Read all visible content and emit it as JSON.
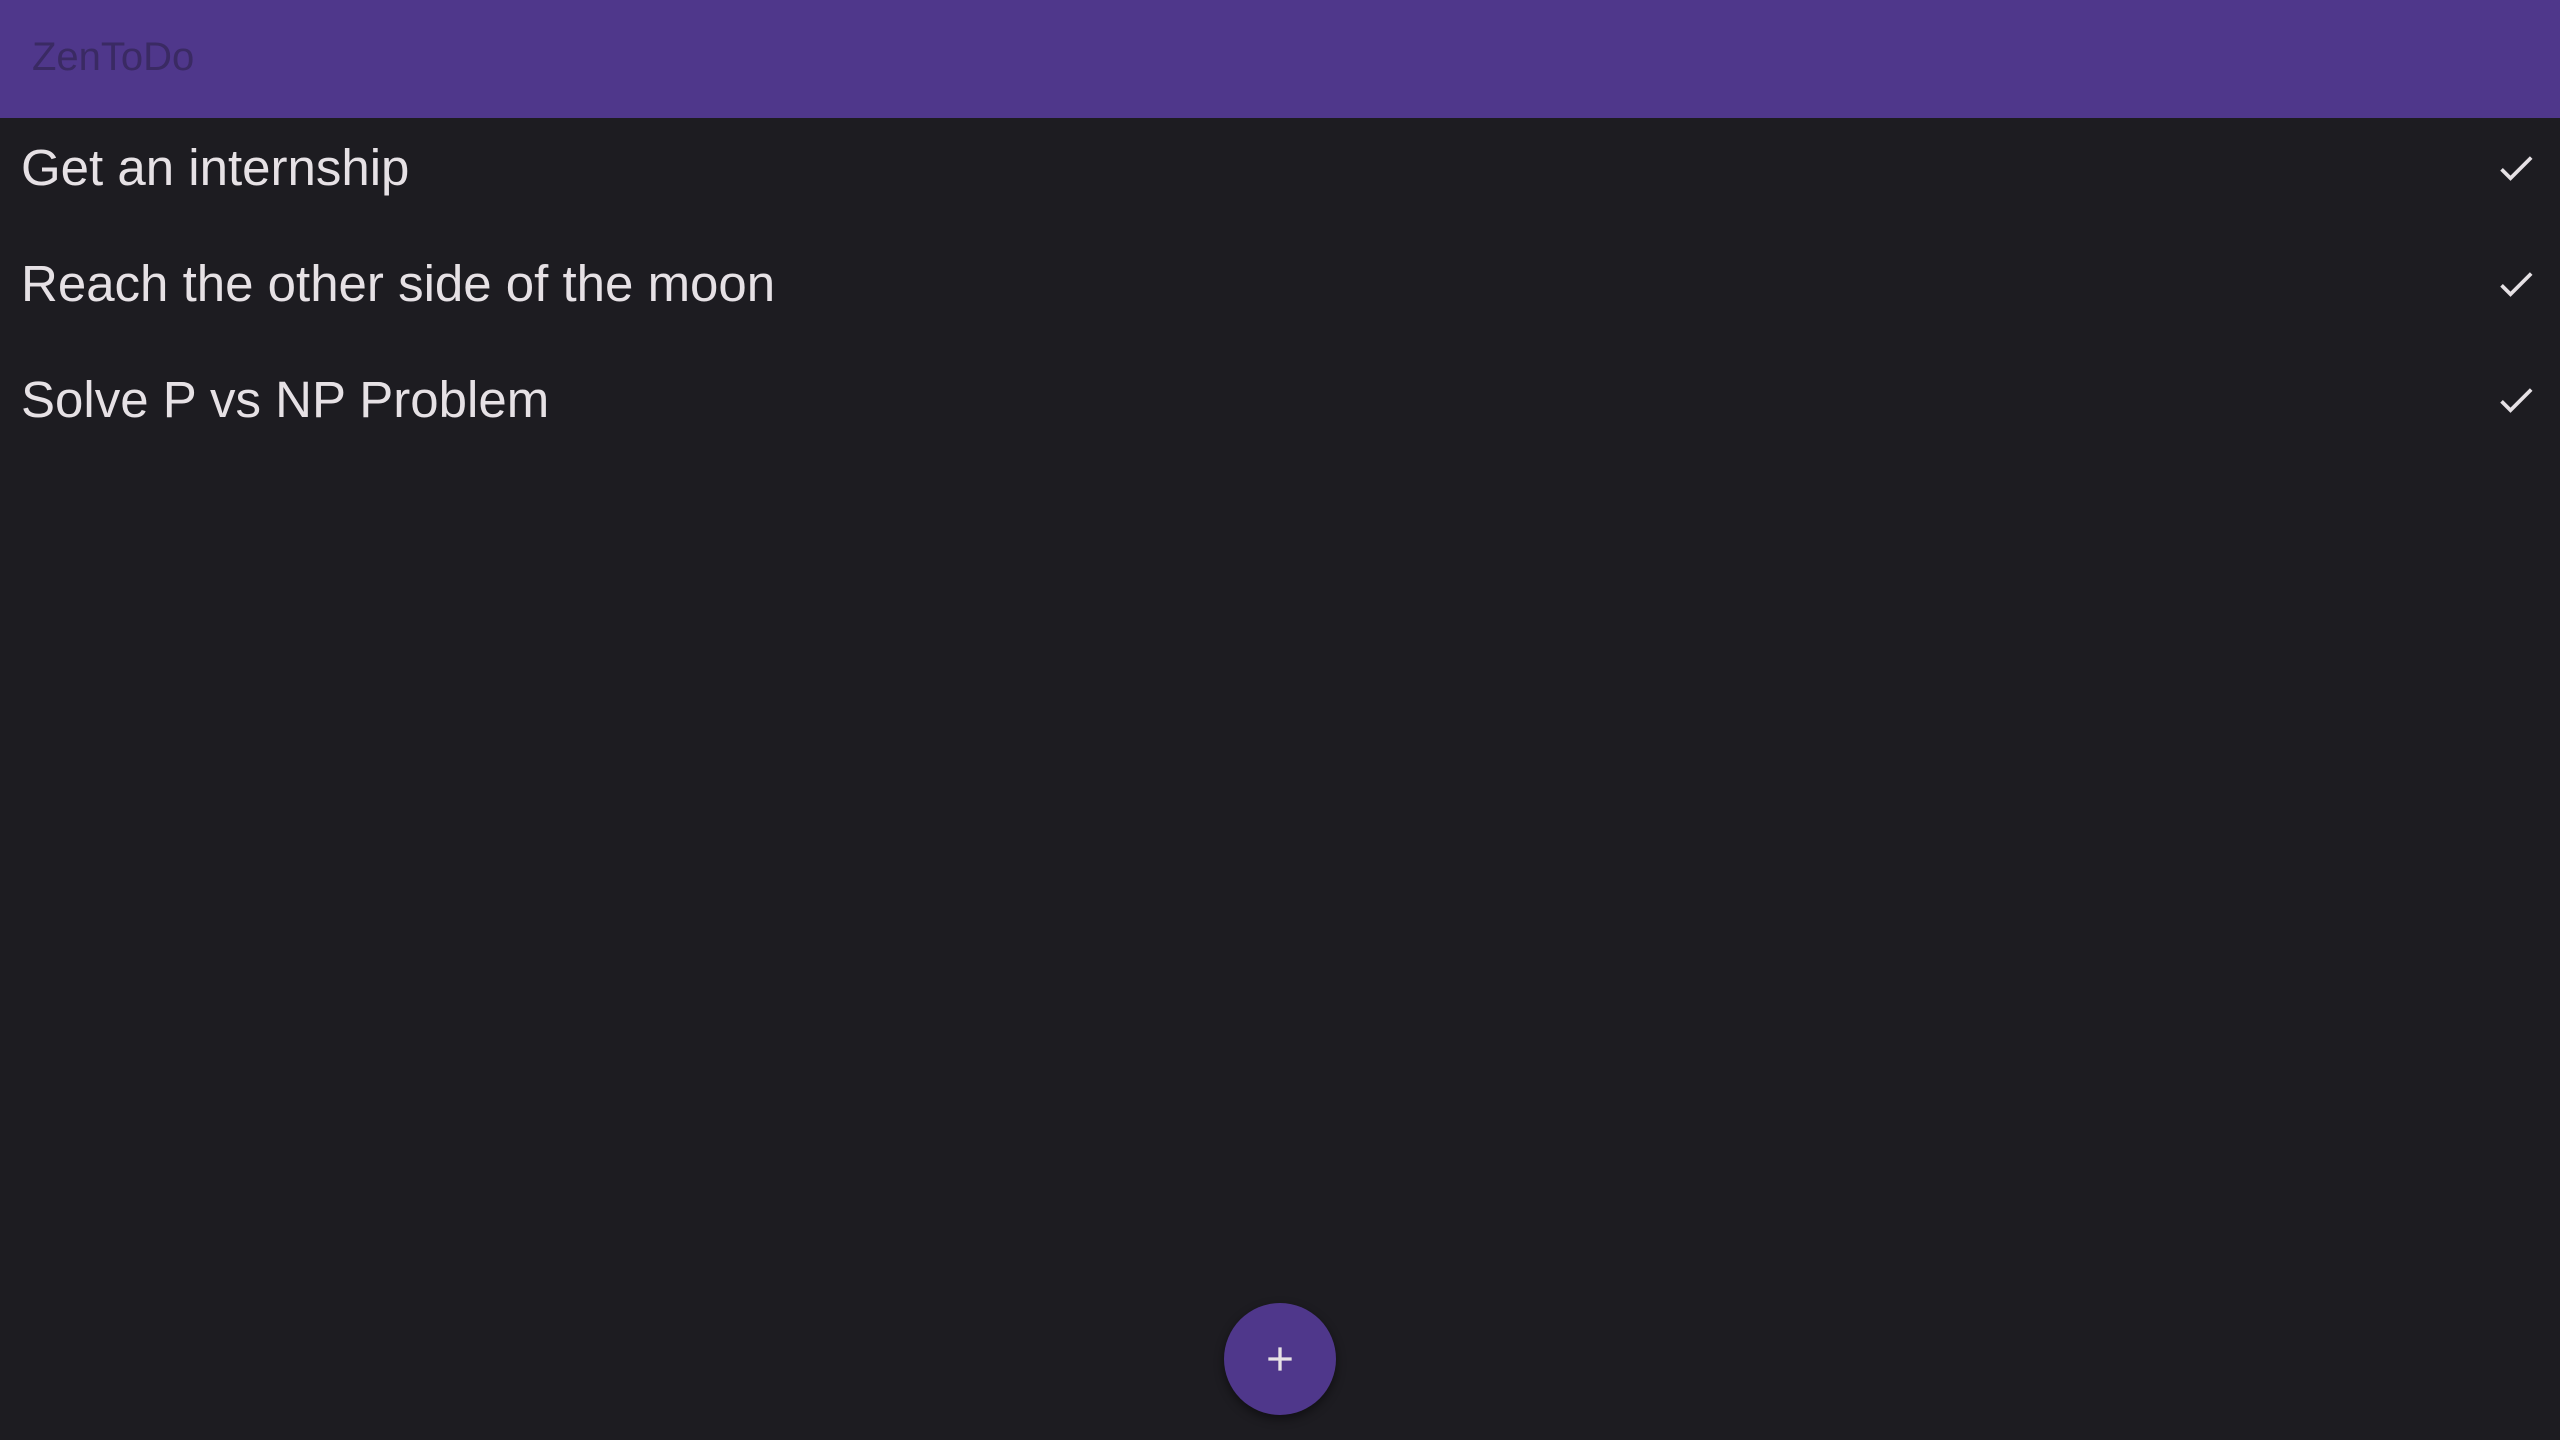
{
  "app": {
    "title": "ZenToDo"
  },
  "tasks": [
    {
      "text": "Get an internship",
      "action_icon": "check-icon"
    },
    {
      "text": "Reach the other side of the moon",
      "action_icon": "check-icon"
    },
    {
      "text": "Solve P vs NP Problem",
      "action_icon": "check-icon"
    }
  ],
  "fab": {
    "icon": "plus-icon"
  },
  "colors": {
    "appbar": "#4f378b",
    "background": "#1d1c21",
    "text": "#e6e1e5",
    "fab": "#4f378b"
  }
}
